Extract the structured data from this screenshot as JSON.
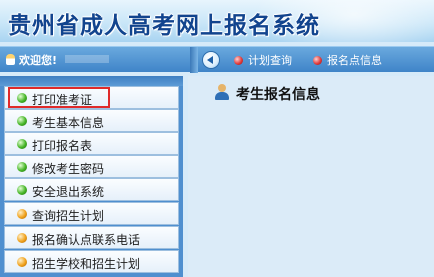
{
  "header": {
    "title": "贵州省成人高考网上报名系统"
  },
  "navbar": {
    "welcome": "欢迎您!",
    "links": [
      {
        "label": "计划查询"
      },
      {
        "label": "报名点信息"
      }
    ]
  },
  "sidebar": {
    "items": [
      {
        "label": "打印准考证",
        "bullet": "green",
        "highlighted": true
      },
      {
        "label": "考生基本信息",
        "bullet": "green"
      },
      {
        "label": "打印报名表",
        "bullet": "green"
      },
      {
        "label": "修改考生密码",
        "bullet": "green"
      },
      {
        "label": "安全退出系统",
        "bullet": "green"
      },
      {
        "label": "查询招生计划",
        "bullet": "orange"
      },
      {
        "label": "报名确认点联系电话",
        "bullet": "orange"
      },
      {
        "label": "招生学校和招生计划",
        "bullet": "orange"
      }
    ]
  },
  "main": {
    "title": "考生报名信息"
  },
  "colors": {
    "title": "#12448e",
    "navbar": "#4a8fd1",
    "highlight": "#e02a2a",
    "menu_bullet_green": "#45b526",
    "menu_bullet_orange": "#f0a21c"
  }
}
